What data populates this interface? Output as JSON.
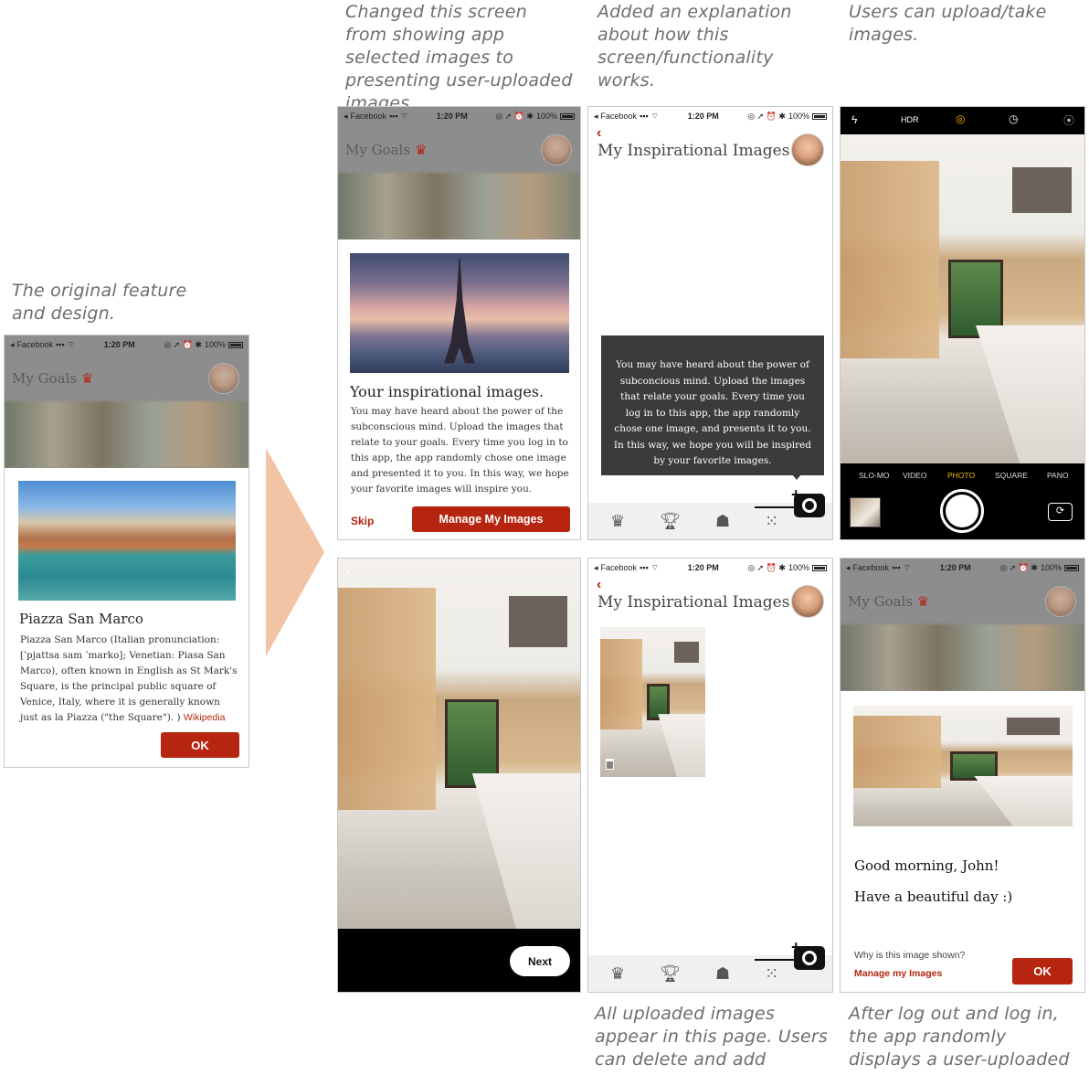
{
  "captions": {
    "original": "The original feature and design.",
    "changed": "Changed this screen from showing app selected images to presenting user-uploaded images.",
    "explanation": "Added an explanation about how this screen/functionality works.",
    "upload": "Users can upload/take images.",
    "all_uploaded": "All uploaded images appear in this page. Users can delete and add images.",
    "after_login": "After log out and log in, the app randomly displays a user-uploaded image."
  },
  "status": {
    "carrier": "Facebook",
    "time": "1:20 PM",
    "battery": "100%"
  },
  "app": {
    "goals_title": "My Goals",
    "inspirational_title": "My Inspirational Images"
  },
  "original_card": {
    "title": "Piazza San Marco",
    "body": "Piazza San Marco (Italian pronunciation: [ˈpjattsa sam ˈmarko]; Venetian: Piasa San Marco), often known in English as St Mark's Square, is the principal public square of Venice, Italy, where it is generally known just as la Piazza (\"the Square\"). )",
    "link": "Wikipedia",
    "ok": "OK"
  },
  "intro_card": {
    "title": "Your inspirational images.",
    "body": "You may have heard about the power of the subconscious mind. Upload the images that relate to your goals. Every time you log in to this app, the app randomly chose one image and presented it to you. In this way, we hope your favorite images will inspire you.",
    "skip": "Skip",
    "manage": "Manage My Images"
  },
  "tooltip": {
    "text": "You may have heard about the power of subconcious mind. Upload the images that relate your goals. Every time you log in to this app, the app randomly chose one image, and presents it to you. In this way, we hope you will be inspired by your favorite images."
  },
  "camera": {
    "hdr": "HDR",
    "modes": [
      "SLO-MO",
      "VIDEO",
      "PHOTO",
      "SQUARE",
      "PANO"
    ],
    "active_mode": "PHOTO"
  },
  "preview": {
    "next": "Next"
  },
  "greeting": {
    "line1": "Good morning, John!",
    "line2": "Have a beautiful day :)",
    "why": "Why is this image shown?",
    "manage": "Manage my Images",
    "ok": "OK"
  },
  "icons": {
    "tabbar": [
      "crown-icon",
      "trophy-icon",
      "book-icon",
      "grid-icon"
    ],
    "camera_top": [
      "flash-icon",
      "live-photo-icon",
      "timer-icon",
      "filters-icon"
    ]
  },
  "colors": {
    "brand_red": "#b5250f",
    "arrow": "#f2c3a4",
    "caption": "#6e6e6e",
    "camera_active": "#f5b700"
  }
}
